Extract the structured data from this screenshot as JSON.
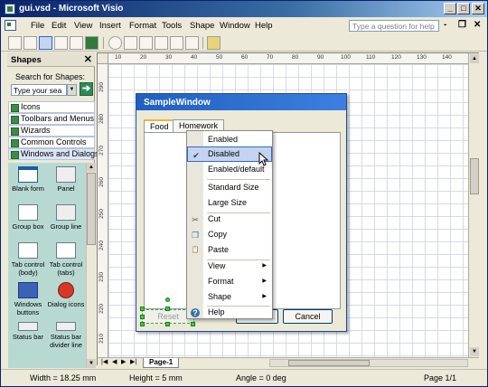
{
  "window": {
    "title": "gui.vsd - Microsoft Visio",
    "min": "_",
    "max": "□",
    "close": "✕"
  },
  "menus": [
    "File",
    "Edit",
    "View",
    "Insert",
    "Format",
    "Tools",
    "Shape",
    "Window",
    "Help"
  ],
  "ask_placeholder": "Type a question for help",
  "mdi": {
    "min": "-",
    "restore": "❐",
    "close": "✕"
  },
  "shapes_pane": {
    "title": "Shapes",
    "close": "✕",
    "search_label": "Search for Shapes:",
    "search_value": "Type your sea",
    "stencils": [
      "Icons",
      "Toolbars and Menus",
      "Wizards",
      "Common Controls",
      "Windows and Dialogs"
    ],
    "masters": [
      {
        "label": "Blank form"
      },
      {
        "label": "Panel"
      },
      {
        "label": "Group box"
      },
      {
        "label": "Group line"
      },
      {
        "label": "Tab control (body)"
      },
      {
        "label": "Tab control (tabs)"
      },
      {
        "label": "Windows buttons"
      },
      {
        "label": "Dialog icons"
      },
      {
        "label": "Status bar"
      },
      {
        "label": "Status bar divider line"
      }
    ]
  },
  "ruler": {
    "h_ticks": [
      "10",
      "20",
      "30",
      "40",
      "50",
      "60",
      "70",
      "80",
      "90",
      "100",
      "110",
      "120",
      "130",
      "140"
    ],
    "v_ticks": [
      "290",
      "280",
      "270",
      "260",
      "250",
      "240",
      "230",
      "220",
      "210"
    ]
  },
  "dialog": {
    "title": "SampleWindow",
    "tabs": [
      "Food",
      "Homework"
    ],
    "cancel_label": "Cancel",
    "reset_label": "Reset"
  },
  "context_menu": {
    "items": [
      {
        "label": "Enabled",
        "icon": ""
      },
      {
        "label": "Disabled",
        "icon": "check-icon",
        "glyph": "✔"
      },
      {
        "label": "Enabled/default",
        "icon": ""
      },
      {
        "label": "Standard Size",
        "icon": ""
      },
      {
        "label": "Large Size",
        "icon": ""
      },
      {
        "label": "Cut",
        "icon": "scissors-icon",
        "glyph": "✂"
      },
      {
        "label": "Copy",
        "icon": "copy-icon",
        "glyph": "❐"
      },
      {
        "label": "Paste",
        "icon": "paste-icon",
        "glyph": "📋"
      },
      {
        "label": "View",
        "icon": "",
        "submenu": "▶"
      },
      {
        "label": "Format",
        "icon": "",
        "submenu": "▶"
      },
      {
        "label": "Shape",
        "icon": "",
        "submenu": "▶"
      },
      {
        "label": "Help",
        "icon": "help-icon",
        "glyph": "?"
      }
    ]
  },
  "page_tab": "Page-1",
  "page_nav": [
    "|◀",
    "◀",
    "▶",
    "▶|"
  ],
  "status": {
    "width": "Width = 18.25 mm",
    "height": "Height = 5 mm",
    "angle": "Angle = 0 deg",
    "page": "Page 1/1"
  },
  "colors": {
    "title_bar": "#0a246a",
    "dialog_title": "#1f5fbf",
    "highlight": "#316ac5",
    "stencil_bg": "#b8d9d2"
  }
}
